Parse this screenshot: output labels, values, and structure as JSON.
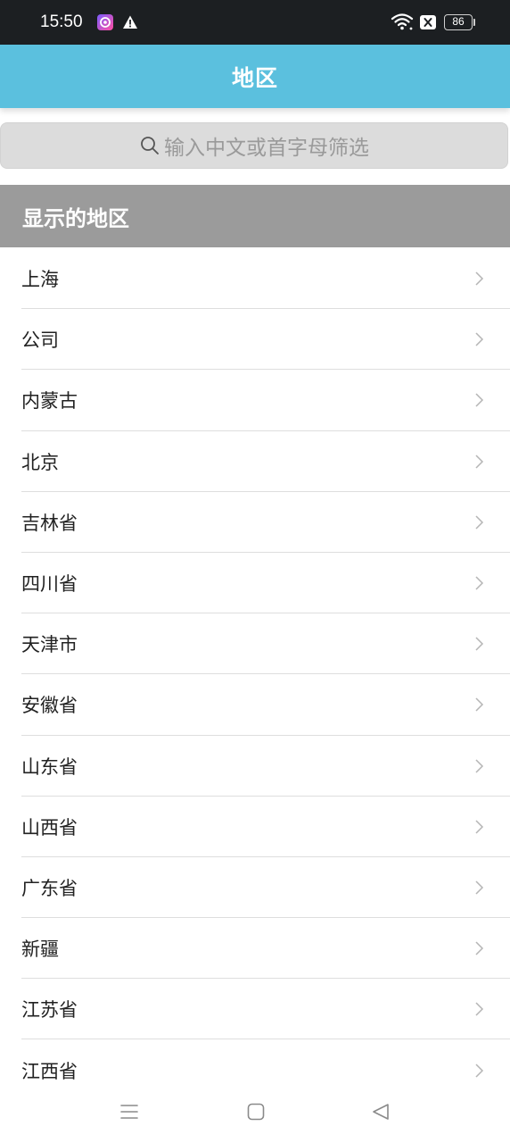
{
  "status_bar": {
    "time": "15:50",
    "battery": "86"
  },
  "header": {
    "title": "地区"
  },
  "search": {
    "placeholder": "输入中文或首字母筛选"
  },
  "section": {
    "title": "显示的地区"
  },
  "regions": [
    "上海",
    "公司",
    "内蒙古",
    "北京",
    "吉林省",
    "四川省",
    "天津市",
    "安徽省",
    "山东省",
    "山西省",
    "广东省",
    "新疆",
    "江苏省",
    "江西省"
  ],
  "colors": {
    "header_bg": "#5bc0de",
    "section_bg": "#9b9b9b",
    "status_bg": "#1c1f22"
  },
  "icons": {
    "search": "search-icon",
    "chevron": "chevron-right-icon",
    "nav_menu": "menu-icon",
    "nav_home": "home-icon",
    "nav_back": "back-icon"
  }
}
